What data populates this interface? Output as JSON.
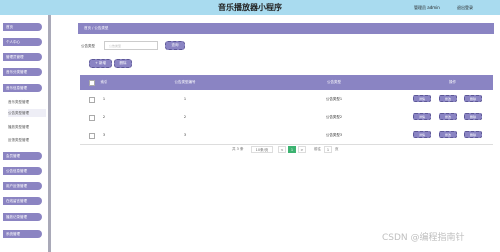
{
  "header": {
    "title": "音乐播放器小程序",
    "admin": "管理员 admin",
    "logout": "退出登录"
  },
  "sidebar": {
    "items": [
      {
        "label": "首页"
      },
      {
        "label": "个人中心"
      },
      {
        "label": "管理员管理"
      },
      {
        "label": "音乐分类管理"
      },
      {
        "label": "音乐信息管理"
      },
      {
        "label": "会员管理"
      },
      {
        "label": "公告信息管理"
      },
      {
        "label": "用户反馈管理"
      },
      {
        "label": "在线留言管理"
      },
      {
        "label": "播放记录管理"
      },
      {
        "label": "系统管理"
      }
    ],
    "sub_items": [
      {
        "label": "音乐类型管理"
      },
      {
        "label": "公告类型管理"
      },
      {
        "label": "播放类型管理"
      },
      {
        "label": "反馈类型管理"
      }
    ]
  },
  "breadcrumb": "首页 / 公告类型",
  "search": {
    "label": "公告类型",
    "placeholder": "公告类型",
    "button": "查询"
  },
  "toolbar": {
    "add": "+ 新增",
    "delete": "删除"
  },
  "table": {
    "headers": [
      "",
      "索引",
      "公告类型编号",
      "公告类型",
      "操作"
    ],
    "rows": [
      {
        "index": "1",
        "code": "1",
        "type": "公告类型1"
      },
      {
        "index": "2",
        "code": "2",
        "type": "公告类型2"
      },
      {
        "index": "3",
        "code": "3",
        "type": "公告类型3"
      }
    ],
    "actions": [
      "详情",
      "修改",
      "删除"
    ]
  },
  "pagination": {
    "total": "共 3 条",
    "page_size": "10条/页",
    "prev": "<",
    "current": "1",
    "next": ">",
    "goto_label": "前往",
    "goto_value": "1",
    "goto_suffix": "页"
  },
  "watermark": "CSDN @编程指南针",
  "colors": {
    "accent": "#8a84c3",
    "topbar": "#a9dbef",
    "current_page": "#3cb371"
  }
}
